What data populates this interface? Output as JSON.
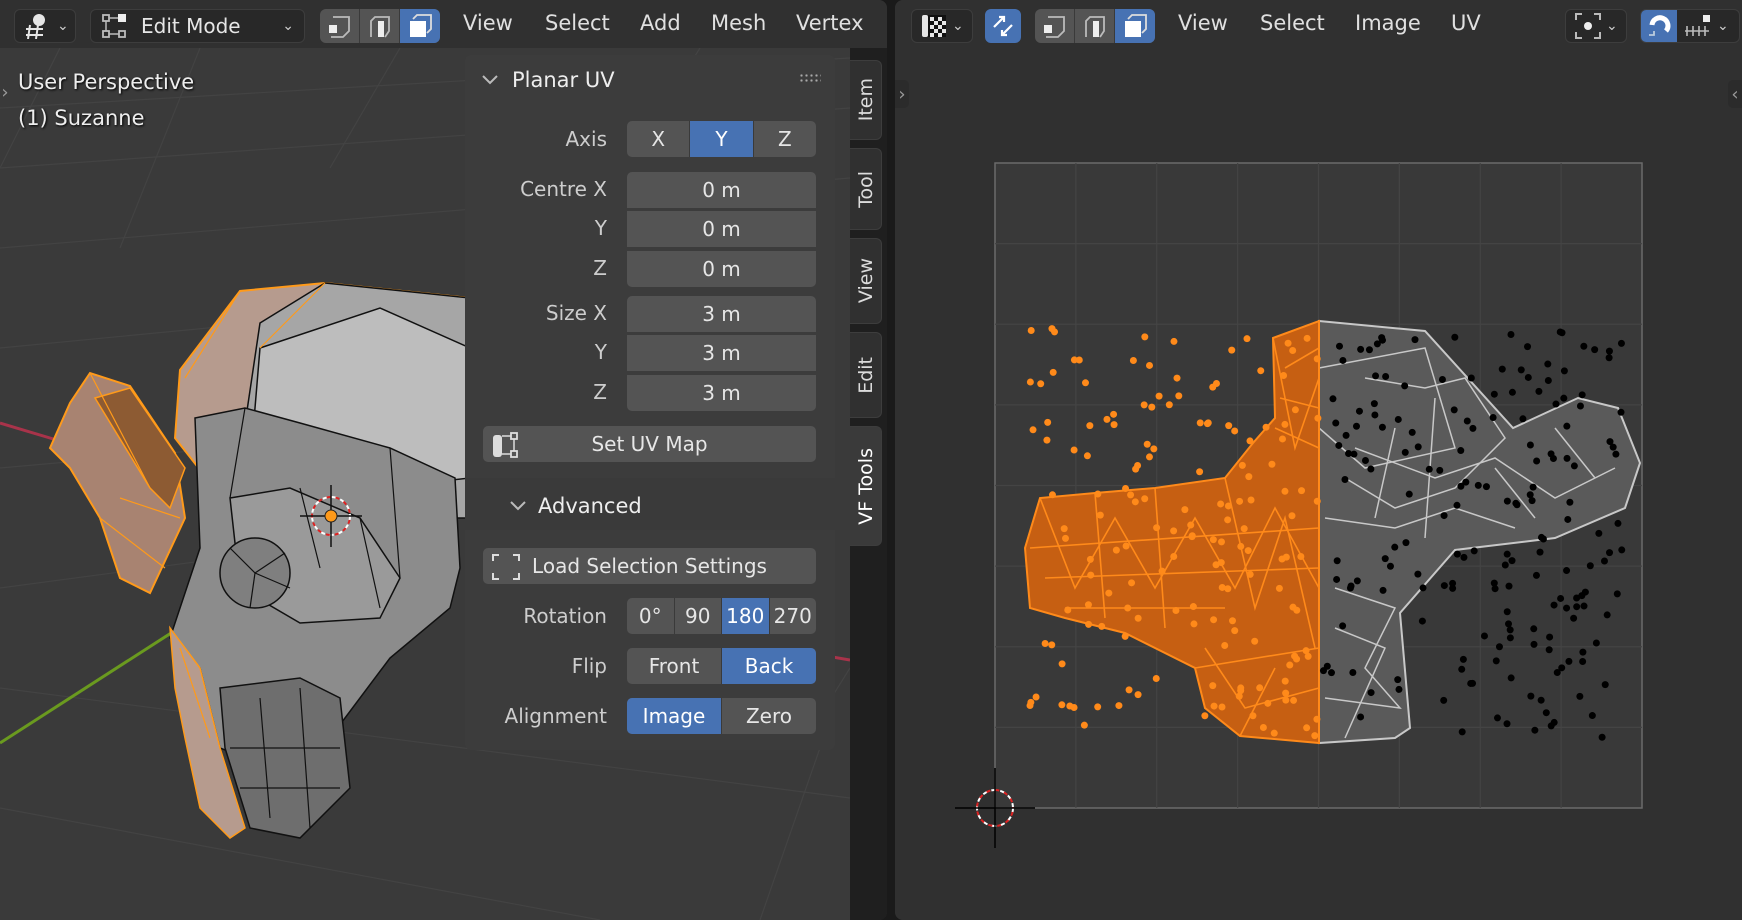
{
  "left_editor": {
    "header": {
      "editor_type_icon": "3d-viewport-icon",
      "mode_dropdown": {
        "label": "Edit Mode",
        "icon": "edit-mode-icon"
      },
      "select_modes": [
        {
          "name": "vertex-select",
          "active": false
        },
        {
          "name": "edge-select",
          "active": false
        },
        {
          "name": "face-select",
          "active": true
        }
      ],
      "menus": [
        "View",
        "Select",
        "Add",
        "Mesh",
        "Vertex"
      ]
    },
    "viewport": {
      "perspective": "User Perspective",
      "object": "(1) Suzanne"
    },
    "sidebar_tabs": [
      "Item",
      "Tool",
      "View",
      "Edit",
      "VF Tools"
    ],
    "active_tab": "VF Tools",
    "panel": {
      "title": "Planar UV",
      "axis": {
        "label": "Axis",
        "options": [
          "X",
          "Y",
          "Z"
        ],
        "selected": "Y"
      },
      "centre": {
        "x_label": "Centre X",
        "x_value": "0 m",
        "y_label": "Y",
        "y_value": "0 m",
        "z_label": "Z",
        "z_value": "0 m"
      },
      "size": {
        "x_label": "Size X",
        "x_value": "3 m",
        "y_label": "Y",
        "y_value": "3 m",
        "z_label": "Z",
        "z_value": "3 m"
      },
      "set_uv_map_label": "Set UV Map",
      "advanced_label": "Advanced",
      "load_selection_label": "Load Selection Settings",
      "rotation": {
        "label": "Rotation",
        "options": [
          "0°",
          "90",
          "180",
          "270"
        ],
        "selected": "180"
      },
      "flip": {
        "label": "Flip",
        "options": [
          "Front",
          "Back"
        ],
        "selected": "Back"
      },
      "alignment": {
        "label": "Alignment",
        "options": [
          "Image",
          "Zero"
        ],
        "selected": "Image"
      }
    }
  },
  "right_editor": {
    "header": {
      "editor_type_icon": "uv-editor-icon",
      "sync_selection_active": true,
      "select_modes": [
        {
          "name": "vertex-select",
          "active": false
        },
        {
          "name": "edge-select",
          "active": false
        },
        {
          "name": "face-select",
          "active": true
        }
      ],
      "menus": [
        "View",
        "Select",
        "Image",
        "UV"
      ],
      "pivot_icon": "pivot-point-icon",
      "snap_active": true,
      "snap_icon": "snap-magnet-icon",
      "snap_target_icon": "snap-increment-icon"
    }
  },
  "colors": {
    "accent": "#4772b3",
    "selection": "#ff8a1a",
    "panel_bg": "#3c3c3c",
    "editor_bg": "#303030"
  }
}
